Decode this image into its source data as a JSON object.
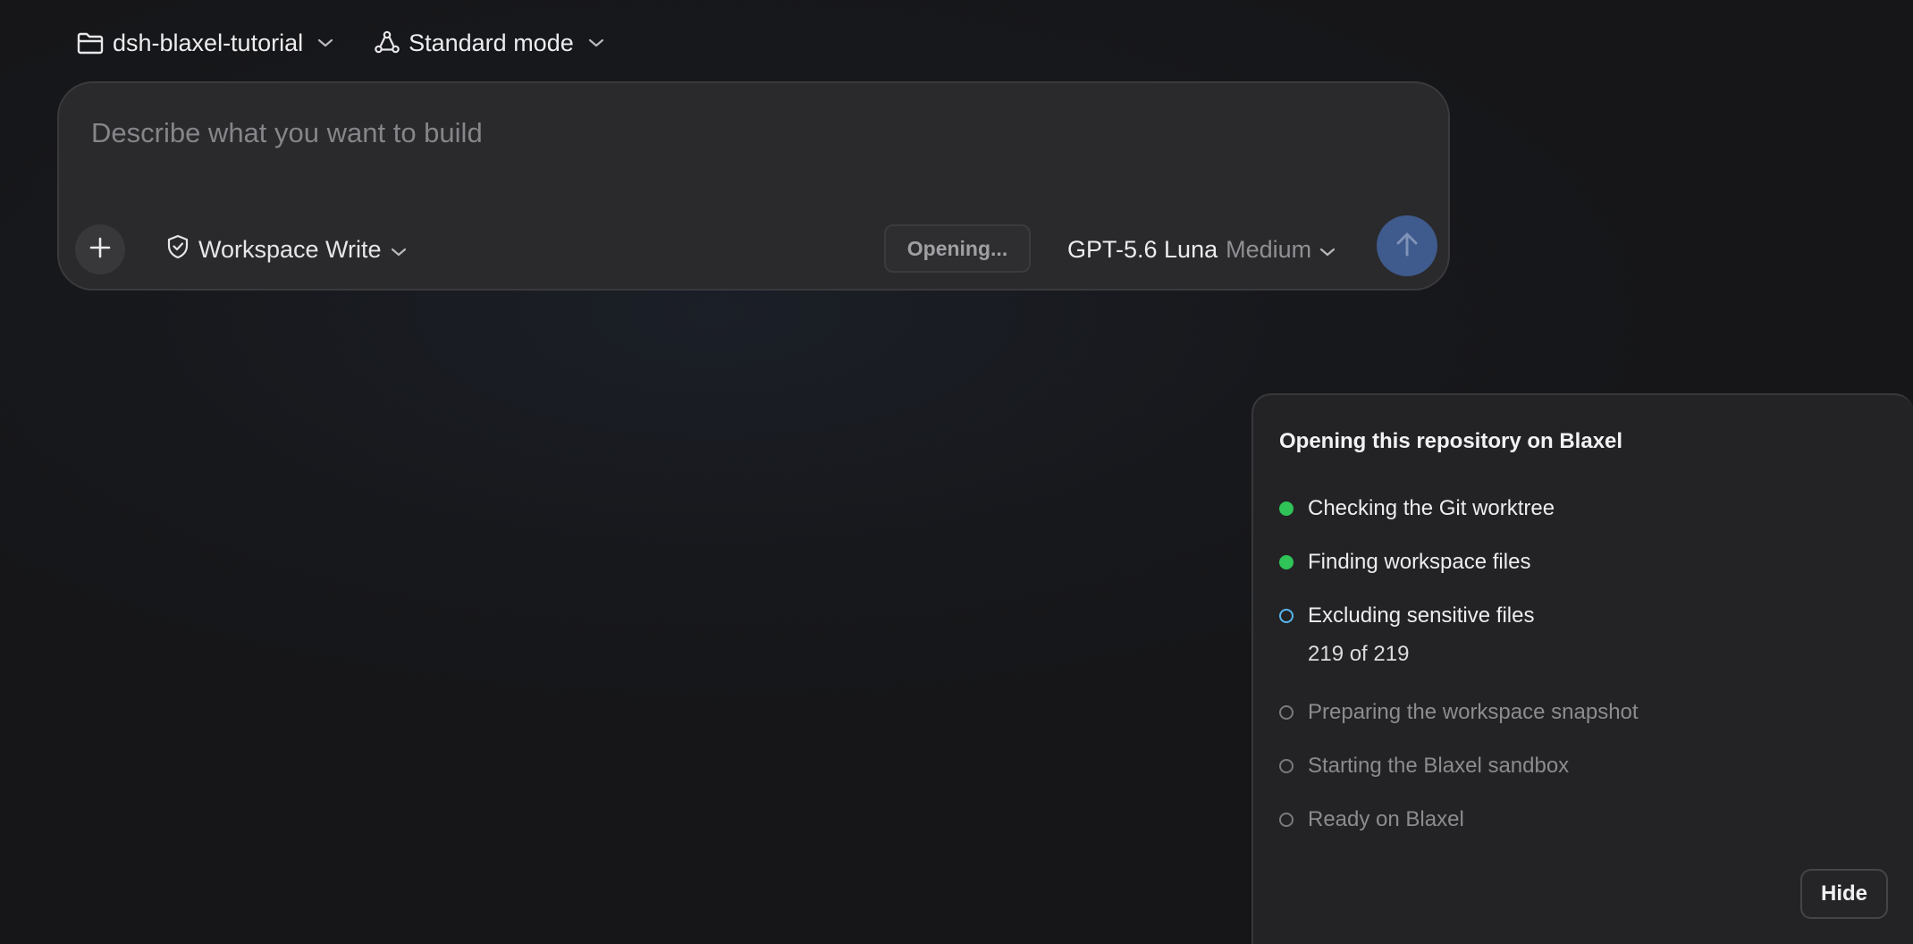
{
  "top": {
    "repo": {
      "label": "dsh-blaxel-tutorial",
      "icon": "folder-icon"
    },
    "mode": {
      "label": "Standard mode",
      "icon": "agents-graph-icon"
    }
  },
  "prompt": {
    "placeholder": "Describe what you want to build",
    "value": "",
    "permission": {
      "label": "Workspace Write",
      "icon": "shield-check-icon"
    },
    "status_button": "Opening...",
    "model": {
      "name": "GPT-5.6 Luna",
      "effort": "Medium"
    },
    "send_icon": "arrow-up-icon",
    "add_icon": "plus-icon"
  },
  "panel": {
    "title": "Opening this repository on Blaxel",
    "steps": [
      {
        "label": "Checking the Git worktree",
        "status": "done"
      },
      {
        "label": "Finding workspace files",
        "status": "done"
      },
      {
        "label": "Excluding sensitive files",
        "status": "active",
        "detail": "219 of 219"
      },
      {
        "label": "Preparing the workspace snapshot",
        "status": "pending"
      },
      {
        "label": "Starting the Blaxel sandbox",
        "status": "pending"
      },
      {
        "label": "Ready on Blaxel",
        "status": "pending"
      }
    ],
    "hide_label": "Hide"
  },
  "colors": {
    "background": "#161618",
    "accent_send": "#3f5a8c",
    "done": "#2fc358",
    "active": "#57b6ee",
    "pending": "#7a7a7e"
  }
}
